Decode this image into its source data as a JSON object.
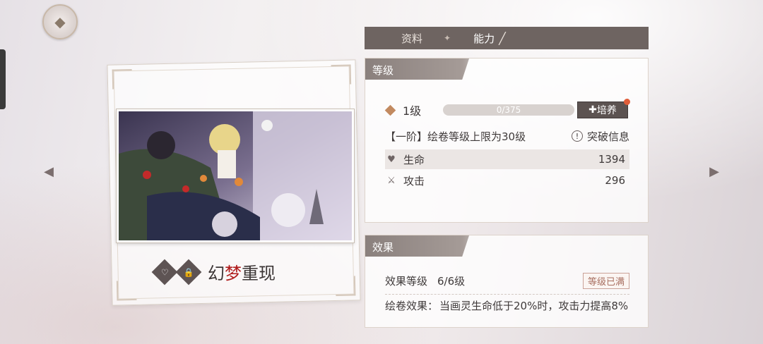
{
  "tabs": {
    "info_label": "资料",
    "ability_label": "能力"
  },
  "card": {
    "name_prefix": "幻",
    "name_highlight": "梦",
    "name_suffix": "重现"
  },
  "level_panel": {
    "title": "等级",
    "level": "1级",
    "progress_text": "0/375",
    "progress_fraction": 0,
    "train_button": "培养",
    "stage_text": "【一阶】绘卷等级上限为30级",
    "breakthrough_label": "突破信息",
    "stats": [
      {
        "icon": "heart-icon",
        "label": "生命",
        "value": "1394"
      },
      {
        "icon": "swords-icon",
        "label": "攻击",
        "value": "296"
      }
    ]
  },
  "effect_panel": {
    "title": "效果",
    "level_label": "效果等级",
    "level_value": "6/6级",
    "max_badge": "等级已满",
    "effect_label": "绘卷效果：",
    "effect_text": "当画灵生命低于20%时，攻击力提高8%"
  },
  "colors": {
    "accent": "#6e6461",
    "highlight": "#b01c1c",
    "dot": "#e05e3a"
  }
}
